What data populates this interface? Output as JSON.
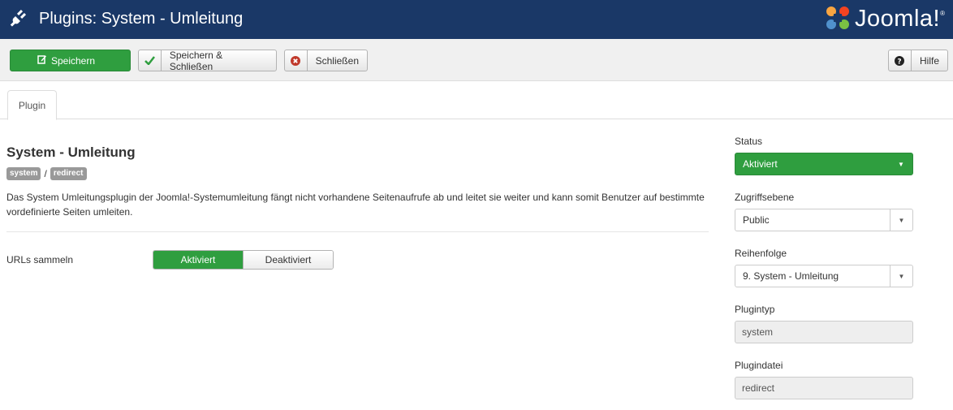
{
  "header": {
    "title": "Plugins: System - Umleitung",
    "logo_text": "Joomla!",
    "logo_reg": "®"
  },
  "toolbar": {
    "save_label": "Speichern",
    "save_close_label": "Speichern & Schließen",
    "close_label": "Schließen",
    "help_label": "Hilfe"
  },
  "tabs": [
    {
      "label": "Plugin"
    }
  ],
  "main": {
    "title": "System - Umleitung",
    "tag_folder": "system",
    "tag_separator": "/",
    "tag_element": "redirect",
    "description": "Das System Umleitungsplugin der Joomla!-Systemumleitung fängt nicht vorhandene Seitenaufrufe ab und leitet sie weiter und kann somit Benutzer auf bestimmte vordefinierte Seiten umleiten.",
    "urls_label": "URLs sammeln",
    "opt_on": "Aktiviert",
    "opt_off": "Deaktiviert"
  },
  "sidebar": {
    "status_label": "Status",
    "status_value": "Aktiviert",
    "access_label": "Zugriffsebene",
    "access_value": "Public",
    "order_label": "Reihenfolge",
    "order_value": "9. System - Umleitung",
    "type_label": "Plugintyp",
    "type_value": "system",
    "file_label": "Plugindatei",
    "file_value": "redirect"
  },
  "colors": {
    "header_bg": "#1a3867",
    "success": "#2f9e3f",
    "danger": "#c0392b"
  },
  "icons": [
    "plug-icon",
    "joomla-logo-icon",
    "edit-icon",
    "check-icon",
    "close-circle-icon",
    "question-circle-icon",
    "caret-down-icon"
  ]
}
